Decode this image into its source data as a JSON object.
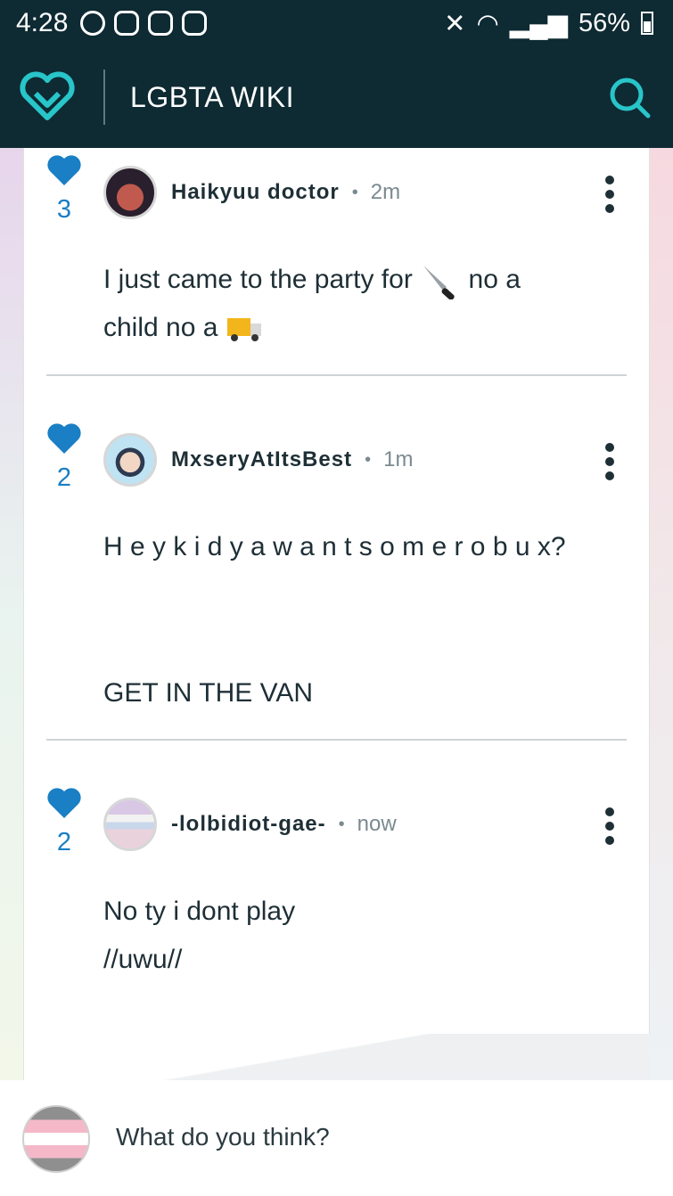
{
  "status_bar": {
    "time": "4:28",
    "battery": "56%"
  },
  "app_bar": {
    "title": "LGBTA WIKI"
  },
  "comments": [
    {
      "likes": "3",
      "author": "Haikyuu doctor",
      "time": "2m",
      "lines": [
        "I just came to the party for",
        "no a",
        "child no a"
      ]
    },
    {
      "likes": "2",
      "author": "MxseryAtItsBest",
      "time": "1m",
      "lines": [
        "H e y k i d y a w a n t s o m e r o b u x?",
        "GET IN THE VAN"
      ]
    },
    {
      "likes": "2",
      "author": "-lolbidiot-gae-",
      "time": "now",
      "lines": [
        "No ty i dont play",
        "//uwu//"
      ]
    }
  ],
  "comment_input": {
    "placeholder": "What do you think?"
  },
  "icons": {
    "logo": "heart-logo-icon",
    "search": "search-icon",
    "like": "heart-icon",
    "more": "more-vertical-icon"
  },
  "colors": {
    "app_bar": "#0e2a33",
    "accent": "#28c5c9",
    "like": "#1a7fc4"
  }
}
